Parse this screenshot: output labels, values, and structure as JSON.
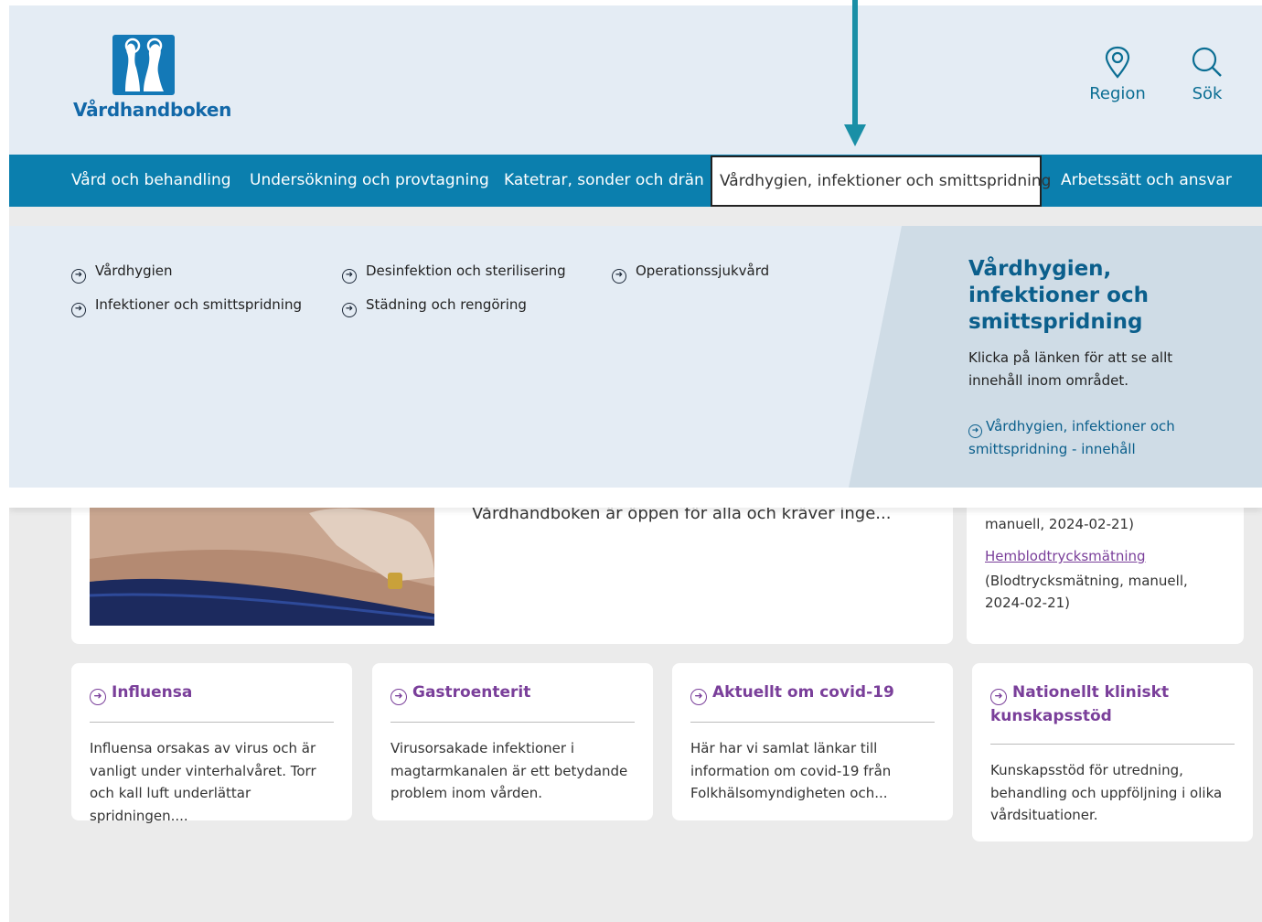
{
  "header": {
    "logo_text": "Vårdhandboken",
    "region_label": "Region",
    "search_label": "Sök"
  },
  "nav": {
    "items": [
      {
        "label": "Vård och behandling"
      },
      {
        "label": "Undersökning och provtagning"
      },
      {
        "label": "Katetrar, sonder och drän"
      },
      {
        "label": "Vårdhygien, infektioner och smittspridning"
      },
      {
        "label": "Arbetssätt och ansvar"
      }
    ]
  },
  "dropdown": {
    "links": [
      {
        "label": "Vårdhygien"
      },
      {
        "label": "Infektioner och smittspridning"
      },
      {
        "label": "Desinfektion och sterilisering"
      },
      {
        "label": "Städning och rengöring"
      },
      {
        "label": "Operationssjukvård"
      }
    ],
    "panel_title": "Vårdhygien, infektioner och smittspridning",
    "panel_desc": "Klicka på länken för att se allt innehåll inom området.",
    "panel_link": "Vårdhygien, infektioner och smittspridning - innehåll"
  },
  "hero": {
    "text": "Vårdhandboken är öppen för alla och kräver inge..."
  },
  "side": {
    "text1": "manuell, 2024-02-21)",
    "link": "Hemblodtrycksmätning",
    "text2": "(Blodtrycksmätning, manuell, 2024-02-21)"
  },
  "cards": [
    {
      "title": "Influensa",
      "text": "Influensa orsakas av virus och är vanligt under vinterhalvåret. Torr och kall luft underlättar spridningen...."
    },
    {
      "title": "Gastroenterit",
      "text": "Virusorsakade infektioner i magtarmkanalen är ett betydande problem inom vården."
    },
    {
      "title": "Aktuellt om covid-19",
      "text": "Här har vi samlat länkar till information om covid-19 från Folkhälsomyndigheten och..."
    },
    {
      "title": "Nationellt kliniskt kunskapsstöd",
      "text": "Kunskapsstöd för utredning, behandling och uppföljning i olika vårdsituationer."
    }
  ],
  "colors": {
    "brand_blue": "#0b7fae",
    "header_bg": "#e4ecf4",
    "link_purple": "#7a3f9a",
    "annotation_arrow": "#1a8fa6"
  }
}
